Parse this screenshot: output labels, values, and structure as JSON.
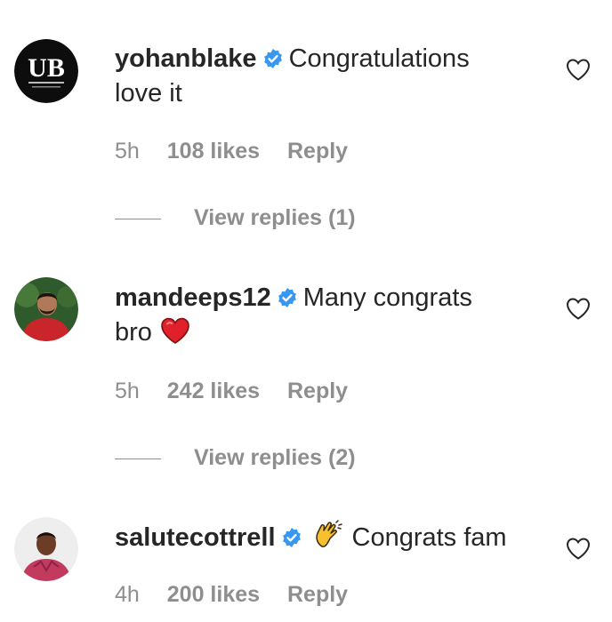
{
  "comments": [
    {
      "username": "yohanblake",
      "text_line1": "Congratulations",
      "text_line2": "love it",
      "time": "5h",
      "likes": "108 likes",
      "reply": "Reply",
      "view_replies": "View replies (1)",
      "avatar_monogram": "UB"
    },
    {
      "username": "mandeeps12",
      "text_line1": "Many congrats",
      "text_line2": "bro",
      "time": "5h",
      "likes": "242 likes",
      "reply": "Reply",
      "view_replies": "View replies (2)",
      "emoji": "red-heart"
    },
    {
      "username": "salutecottrell",
      "text_line1": "Congrats fam",
      "time": "4h",
      "likes": "200 likes",
      "reply": "Reply",
      "emoji": "clapping-hands"
    }
  ],
  "colors": {
    "text": "#262626",
    "secondary": "#8e8e8e",
    "verified": "#3897f0",
    "heart_emoji": "#e0202a",
    "clap_emoji": "#f6c02f"
  },
  "icons": [
    "verified-badge-icon",
    "heart-outline-icon",
    "red-heart-emoji",
    "clapping-hands-emoji"
  ]
}
